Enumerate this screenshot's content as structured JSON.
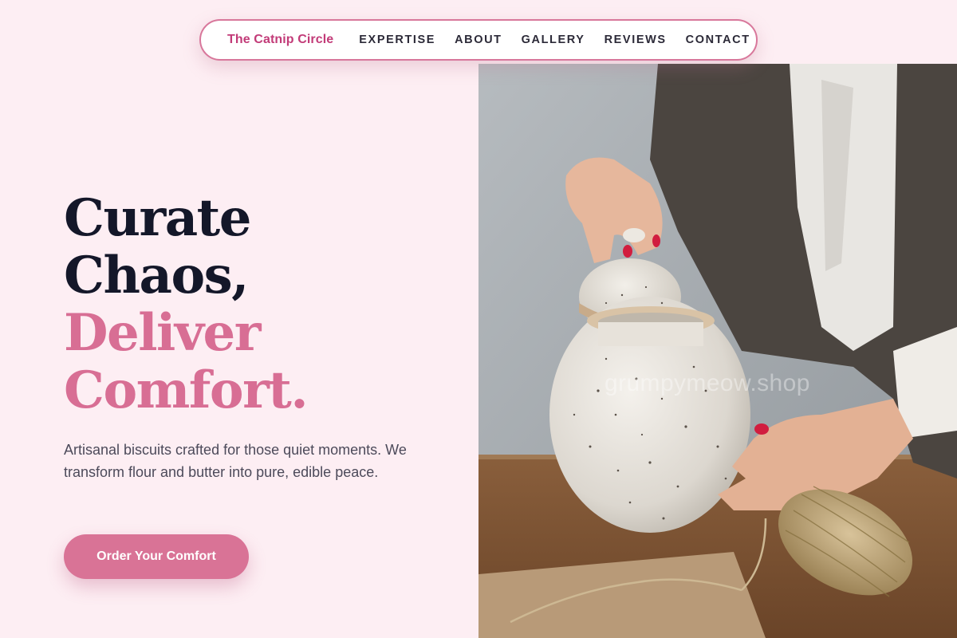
{
  "nav": {
    "brand": "The Catnip Circle",
    "links": [
      "EXPERTISE",
      "ABOUT",
      "GALLERY",
      "REVIEWS",
      "CONTACT"
    ]
  },
  "hero": {
    "headline_line1": "Curate",
    "headline_line2": "Chaos,",
    "headline_line3": "Deliver",
    "headline_line4": "Comfort.",
    "subtext": "Artisanal biscuits crafted for those quiet moments. We transform flour and butter into pure, edible peace.",
    "cta_label": "Order Your Comfort"
  },
  "photo": {
    "watermark": "grumpymeow.shop"
  },
  "colors": {
    "page_bg": "#fdeef3",
    "accent": "#d97396",
    "brand": "#c23b78",
    "headline_dark": "#141729",
    "headline_pink": "#d86e94"
  }
}
